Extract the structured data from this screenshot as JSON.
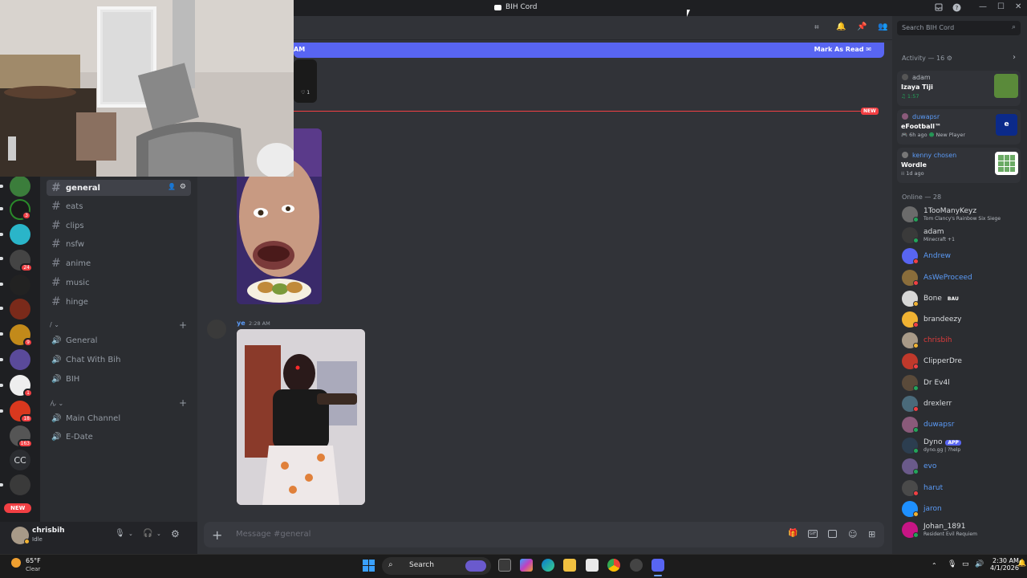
{
  "window": {
    "title": "BIH Cord"
  },
  "header": {
    "search_placeholder": "Search BIH Cord"
  },
  "banner": {
    "time_fragment": "AM",
    "mark_as_read": "Mark As Read"
  },
  "new_divider": "NEW",
  "guilds": {
    "badges": [
      "3",
      "24",
      "9",
      "1",
      "18",
      "163"
    ],
    "text_icon": "CC",
    "new_badge": "NEW"
  },
  "channels": {
    "text": [
      {
        "name": "general",
        "active": true
      },
      {
        "name": "eats"
      },
      {
        "name": "clips"
      },
      {
        "name": "nsfw"
      },
      {
        "name": "anime"
      },
      {
        "name": "music"
      },
      {
        "name": "hinge"
      }
    ],
    "category1": "/ ⌄",
    "voice1": [
      "General",
      "Chat With Bih",
      "BIH"
    ],
    "category2": "ん ⌄",
    "voice2": [
      "Main Channel",
      "E-Date"
    ]
  },
  "user_panel": {
    "name": "chrisbih",
    "status": "Idle"
  },
  "messages": [
    {
      "author": "ye",
      "time": "2:28 AM"
    }
  ],
  "composer": {
    "placeholder": "Message #general"
  },
  "activity": {
    "header": "Activity — 16",
    "cards": [
      {
        "user": "adam",
        "game": "Izaya Tiji",
        "sub": "♫ 1:57"
      },
      {
        "user": "duwapsr",
        "game": "eFootball™",
        "sub": "6h ago",
        "sub2": "New Player"
      },
      {
        "user": "kenny chosen",
        "game": "Wordle",
        "sub": "1d ago"
      }
    ]
  },
  "online": {
    "header": "Online — 28",
    "members": [
      {
        "name": "1TooManyKeyz",
        "sub": "Tom Clancy's Rainbow Six Siege",
        "color": "#dbdee1",
        "status": "#23a55a",
        "avatar": "#6b6b6b"
      },
      {
        "name": "adam",
        "sub": "Minecraft +1",
        "color": "#dbdee1",
        "status": "#23a55a",
        "avatar": "#3a3a3a"
      },
      {
        "name": "Andrew",
        "sub": "",
        "color": "#5b9bf7",
        "status": "#f23f43",
        "avatar": "#5865f2"
      },
      {
        "name": "AsWeProceed",
        "sub": "",
        "color": "#5b9bf7",
        "status": "#f23f43",
        "avatar": "#8a6d3b"
      },
      {
        "name": "Bone",
        "tag": "BAU",
        "sub": "",
        "color": "#dbdee1",
        "status": "#f0b232",
        "avatar": "#d7d7d7"
      },
      {
        "name": "brandeezy",
        "sub": "",
        "color": "#dbdee1",
        "status": "#f23f43",
        "avatar": "#f0b232"
      },
      {
        "name": "chrisbih",
        "sub": "",
        "color": "#e03b3b",
        "status": "#f0b232",
        "avatar": "#a89a88"
      },
      {
        "name": "ClipperDre",
        "sub": "",
        "color": "#dbdee1",
        "status": "#f23f43",
        "avatar": "#c0392b"
      },
      {
        "name": "Dr Ev4l",
        "sub": "",
        "color": "#dbdee1",
        "status": "#23a55a",
        "avatar": "#5a4a3a"
      },
      {
        "name": "drexlerr",
        "sub": "",
        "color": "#dbdee1",
        "status": "#f23f43",
        "avatar": "#4a6a7a"
      },
      {
        "name": "duwapsr",
        "sub": "",
        "color": "#5b9bf7",
        "status": "#23a55a",
        "avatar": "#8a5a7a"
      },
      {
        "name": "Dyno",
        "tag": "APP",
        "sub": "dyno.gg | ?help",
        "color": "#dbdee1",
        "status": "#23a55a",
        "avatar": "#2c3e50"
      },
      {
        "name": "evo",
        "sub": "",
        "color": "#5b9bf7",
        "status": "#23a55a",
        "avatar": "#6a5a8a"
      },
      {
        "name": "harut",
        "sub": "",
        "color": "#5b9bf7",
        "status": "#f23f43",
        "avatar": "#4a4a4a"
      },
      {
        "name": "jaron",
        "sub": "",
        "color": "#5b9bf7",
        "status": "#f0b232",
        "avatar": "#1e90ff"
      },
      {
        "name": "Johan_1891",
        "sub": "Resident Evil Requiem",
        "color": "#dbdee1",
        "status": "#23a55a",
        "avatar": "#c71585"
      }
    ]
  },
  "taskbar": {
    "weather_temp": "65°F",
    "weather_desc": "Clear",
    "search_label": "Search",
    "time": "2:30 AM",
    "date": "4/1/2026"
  }
}
